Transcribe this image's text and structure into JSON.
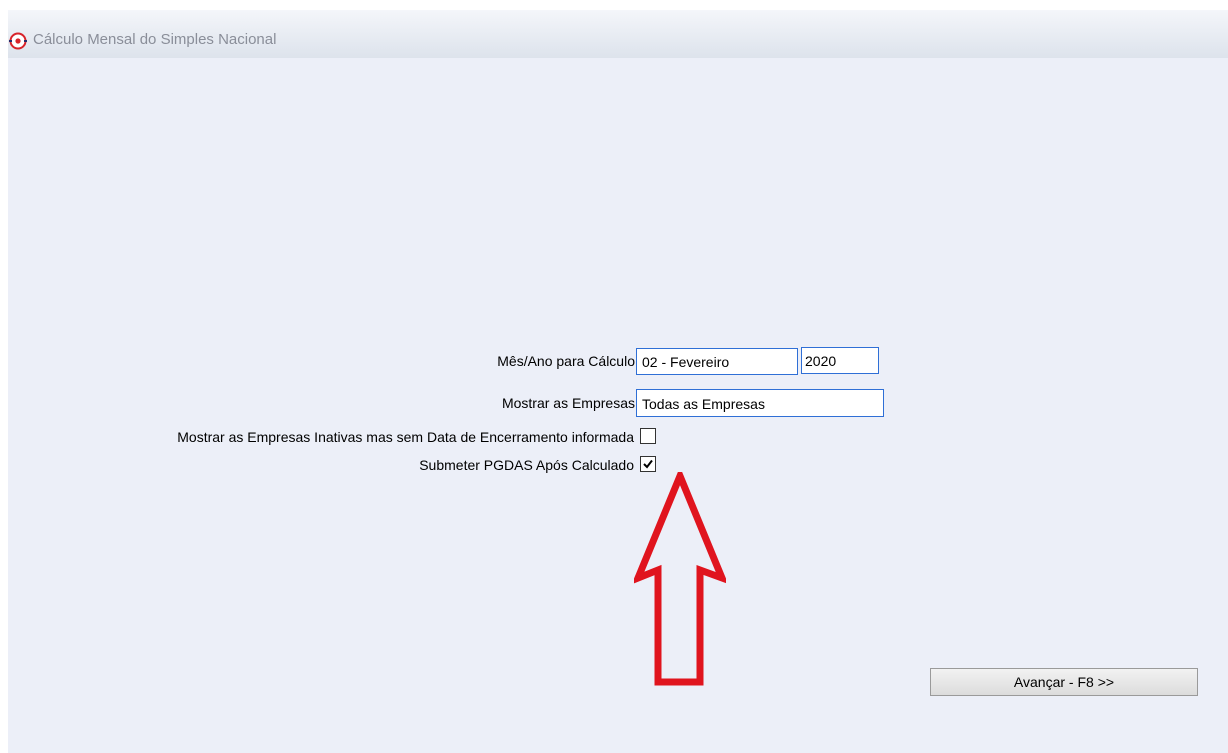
{
  "window": {
    "title": "Cálculo Mensal do Simples Nacional",
    "icon": "target-icon"
  },
  "form": {
    "month_year_label": "Mês/Ano para Cálculo",
    "month_value": "02 - Fevereiro",
    "year_value": "2020",
    "show_companies_label": "Mostrar as Empresas",
    "show_companies_value": "Todas as Empresas",
    "inactive_label": "Mostrar as Empresas Inativas mas sem Data de Encerramento informada",
    "inactive_checked": false,
    "submit_pgdas_label": "Submeter PGDAS Após Calculado",
    "submit_pgdas_checked": true
  },
  "buttons": {
    "next_label": "Avançar - F8 >>"
  },
  "annotation": {
    "arrow_color": "#e0141e",
    "arrow_icon": "up-arrow-icon"
  }
}
